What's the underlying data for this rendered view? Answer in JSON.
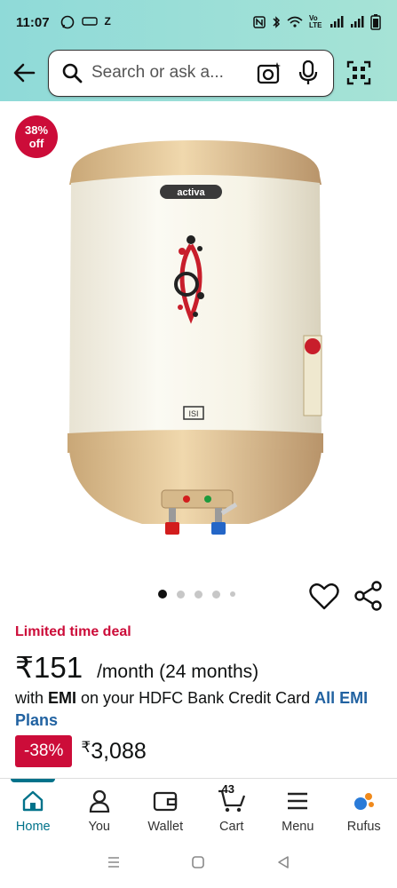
{
  "status_bar": {
    "time": "11:07",
    "left_icons": [
      "whatsapp-icon",
      "vpn-icon",
      "z-icon"
    ],
    "left_text": "Z",
    "right_text": "Vo LTE"
  },
  "search": {
    "placeholder": "Search or ask a..."
  },
  "product": {
    "discount_badge": {
      "percent": "38%",
      "suffix": "off"
    },
    "brand_logo": "activa",
    "carousel": {
      "count": 5,
      "active_index": 0
    }
  },
  "deal": {
    "label": "Limited time deal"
  },
  "price": {
    "emi_amount": "₹151",
    "emi_period": "/month (24 months)",
    "emi_text_prefix": "with ",
    "emi_text_bold": "EMI",
    "emi_text_suffix": " on your HDFC Bank Credit Card ",
    "emi_link": "All EMI Plans",
    "discount_chip": "-38%",
    "mrp_symbol": "₹",
    "mrp_value": "3,088"
  },
  "bottom_nav": {
    "items": [
      {
        "label": "Home",
        "icon": "home-icon",
        "active": true
      },
      {
        "label": "You",
        "icon": "user-icon",
        "active": false
      },
      {
        "label": "Wallet",
        "icon": "wallet-icon",
        "active": false
      },
      {
        "label": "Cart",
        "icon": "cart-icon",
        "active": false,
        "badge": "43"
      },
      {
        "label": "Menu",
        "icon": "menu-icon",
        "active": false
      },
      {
        "label": "Rufus",
        "icon": "rufus-icon",
        "active": false
      }
    ]
  },
  "colors": {
    "accent": "#00728a",
    "deal": "#cc0c39",
    "link": "#2162a1",
    "header": "#a6e3d6"
  }
}
